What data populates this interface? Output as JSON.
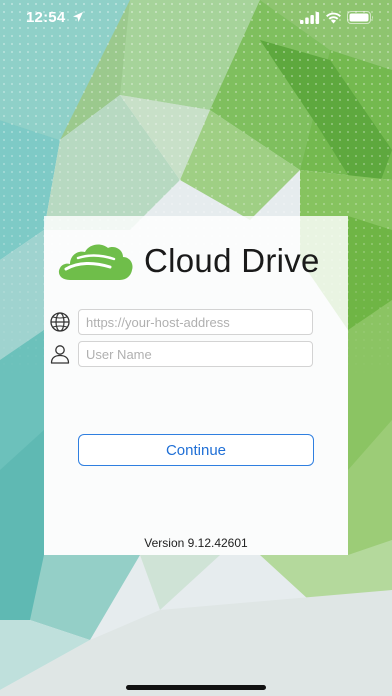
{
  "status_bar": {
    "time": "12:54",
    "icons": [
      "location-arrow-icon",
      "cellular-signal-icon",
      "wifi-icon",
      "battery-icon"
    ]
  },
  "login": {
    "brand_name": "Cloud Drive",
    "logo_icon": "cloud-icon",
    "host_field": {
      "icon": "globe-icon",
      "placeholder": "https://your-host-address",
      "value": ""
    },
    "username_field": {
      "icon": "user-icon",
      "placeholder": "User Name",
      "value": ""
    },
    "continue_label": "Continue",
    "version_text": "Version 9.12.42601"
  },
  "colors": {
    "brand_green": "#6fbe4a",
    "button_blue": "#1f6fd6",
    "card_background": "#ffffff"
  }
}
